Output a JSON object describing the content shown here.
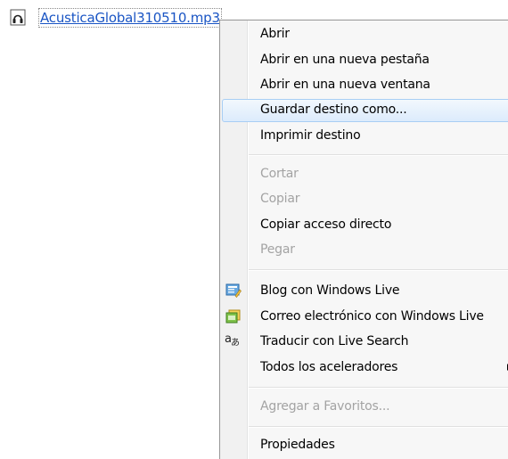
{
  "file": {
    "link_text": "AcusticaGlobal310510.mp3",
    "icon": "audio-file-icon"
  },
  "context_menu": {
    "items": [
      {
        "label": "Abrir",
        "enabled": true
      },
      {
        "label": "Abrir en una nueva pestaña",
        "enabled": true
      },
      {
        "label": "Abrir en una nueva ventana",
        "enabled": true
      },
      {
        "label": "Guardar destino como...",
        "enabled": true,
        "highlighted": true
      },
      {
        "label": "Imprimir destino",
        "enabled": true
      },
      {
        "label": "Cortar",
        "enabled": false
      },
      {
        "label": "Copiar",
        "enabled": false
      },
      {
        "label": "Copiar acceso directo",
        "enabled": true
      },
      {
        "label": "Pegar",
        "enabled": false
      },
      {
        "label": "Blog con Windows Live",
        "enabled": true,
        "icon": "windows-live-blog-icon"
      },
      {
        "label": "Correo electrónico con Windows Live",
        "enabled": true,
        "icon": "windows-live-mail-icon"
      },
      {
        "label": "Traducir con Live Search",
        "enabled": true,
        "icon": "translate-icon"
      },
      {
        "label": "Todos los aceleradores",
        "enabled": true,
        "submenu": true
      },
      {
        "label": "Agregar a Favoritos...",
        "enabled": false
      },
      {
        "label": "Propiedades",
        "enabled": true
      }
    ]
  },
  "colors": {
    "link": "#1a55c4",
    "highlight_border": "#a8cef4",
    "disabled_text": "#a3a3a3"
  }
}
